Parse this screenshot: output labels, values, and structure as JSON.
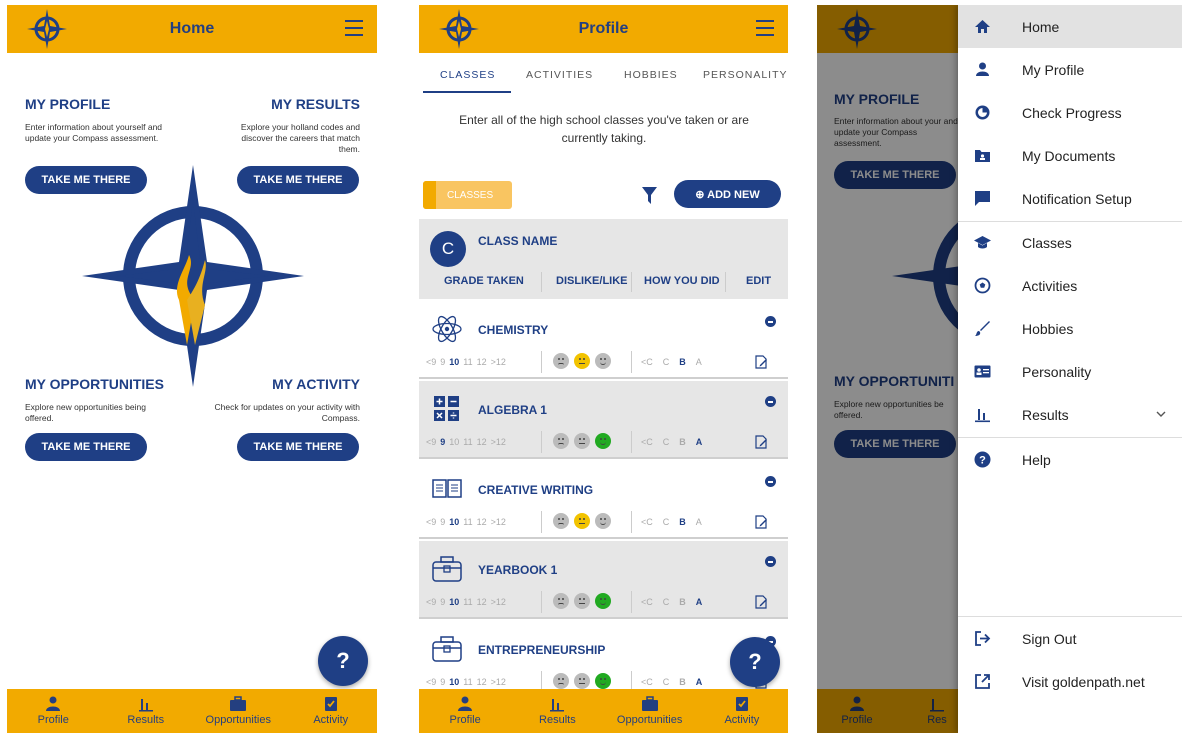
{
  "colors": {
    "accent": "#f2aa00",
    "primary": "#1f3f85",
    "text": "#222222",
    "positive": "#22aa22"
  },
  "home": {
    "title": "Home",
    "sections": [
      {
        "heading": "MY PROFILE",
        "desc": "Enter information about yourself and update your Compass assessment.",
        "button": "TAKE ME THERE"
      },
      {
        "heading": "MY RESULTS",
        "desc": "Explore your holland codes and discover the careers that match them.",
        "button": "TAKE ME THERE"
      },
      {
        "heading": "MY OPPORTUNITIES",
        "desc": "Explore new opportunities being offered.",
        "button": "TAKE ME THERE"
      },
      {
        "heading": "MY ACTIVITY",
        "desc": "Check for updates on your activity with Compass.",
        "button": "TAKE ME THERE"
      }
    ],
    "help": "?"
  },
  "bottom_nav": [
    "Profile",
    "Results",
    "Opportunities",
    "Activity"
  ],
  "profile": {
    "title": "Profile",
    "tabs": [
      "CLASSES",
      "ACTIVITIES",
      "HOBBIES",
      "PERSONALITY"
    ],
    "intro": "Enter all of the high school classes you've taken or are currently taking.",
    "chip": "CLASSES",
    "add_new": "⊕ ADD NEW",
    "header": {
      "avatar": "C",
      "name": "CLASS NAME",
      "cols": [
        "GRADE TAKEN",
        "DISLIKE/LIKE",
        "HOW YOU DID",
        "EDIT"
      ]
    },
    "grade_options": [
      "<9",
      "9",
      "10",
      "11",
      "12",
      ">12"
    ],
    "mark_options": [
      "<C",
      "C",
      "B",
      "A"
    ],
    "classes": [
      {
        "name": "CHEMISTRY",
        "icon": "atom-icon",
        "grade": "10",
        "like": "neutral",
        "mark": "B"
      },
      {
        "name": "ALGEBRA 1",
        "icon": "math-icon",
        "grade": "9",
        "like": "happy",
        "mark": "A"
      },
      {
        "name": "CREATIVE WRITING",
        "icon": "book-icon",
        "grade": "10",
        "like": "neutral",
        "mark": "B"
      },
      {
        "name": "YEARBOOK 1",
        "icon": "briefcase-icon",
        "grade": "10",
        "like": "happy",
        "mark": "A"
      },
      {
        "name": "ENTREPRENEURSHIP",
        "icon": "briefcase-icon",
        "grade": "10",
        "like": "happy",
        "mark": "A"
      }
    ],
    "help": "?"
  },
  "drawer": {
    "bg_home": {
      "h1": "MY PROFILE",
      "d1": "Enter information about your and update your Compass assessment.",
      "b1": "TAKE ME THERE",
      "h2": "MY OPPORTUNITI",
      "d2": "Explore new opportunities be offered.",
      "b2": "TAKE ME THERE",
      "nav1": "Profile",
      "nav2": "Res"
    },
    "items": [
      {
        "label": "Home",
        "icon": "home-icon"
      },
      {
        "label": "My Profile",
        "icon": "person-icon"
      },
      {
        "label": "Check Progress",
        "icon": "progress-icon"
      },
      {
        "label": "My Documents",
        "icon": "folder-icon"
      },
      {
        "label": "Notification Setup",
        "icon": "chat-icon"
      },
      {
        "label": "Classes",
        "icon": "graduation-cap-icon"
      },
      {
        "label": "Activities",
        "icon": "soccer-ball-icon"
      },
      {
        "label": "Hobbies",
        "icon": "brush-icon"
      },
      {
        "label": "Personality",
        "icon": "id-card-icon"
      },
      {
        "label": "Results",
        "icon": "bar-chart-icon"
      },
      {
        "label": "Help",
        "icon": "help-icon"
      }
    ],
    "footer": [
      {
        "label": "Sign Out",
        "icon": "sign-out-icon"
      },
      {
        "label": "Visit goldenpath.net",
        "icon": "external-link-icon"
      }
    ]
  }
}
